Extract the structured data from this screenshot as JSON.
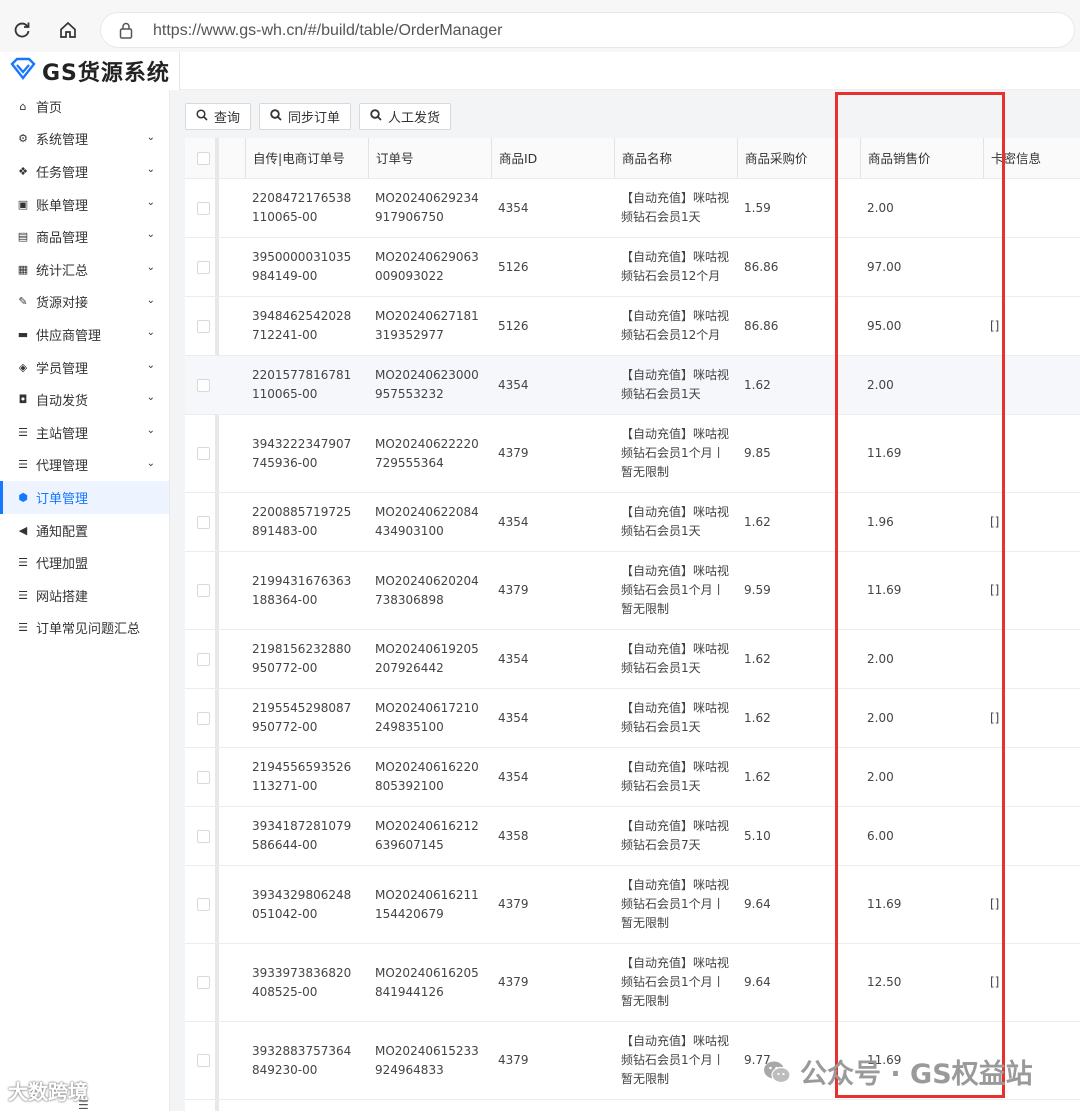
{
  "browser": {
    "url": "https://www.gs-wh.cn/#/build/table/OrderManager"
  },
  "app": {
    "title": "GS货源系统"
  },
  "sidebar": {
    "items": [
      {
        "label": "首页",
        "icon": "home-icon",
        "glyph": "⌂",
        "has_children": false,
        "active": false
      },
      {
        "label": "系统管理",
        "icon": "gears-icon",
        "glyph": "⚙",
        "has_children": true,
        "active": false
      },
      {
        "label": "任务管理",
        "icon": "cubes-icon",
        "glyph": "❖",
        "has_children": true,
        "active": false
      },
      {
        "label": "账单管理",
        "icon": "money-icon",
        "glyph": "▣",
        "has_children": true,
        "active": false
      },
      {
        "label": "商品管理",
        "icon": "calendar-icon",
        "glyph": "▤",
        "has_children": true,
        "active": false
      },
      {
        "label": "统计汇总",
        "icon": "table-icon",
        "glyph": "▦",
        "has_children": true,
        "active": false
      },
      {
        "label": "货源对接",
        "icon": "plug-icon",
        "glyph": "✎",
        "has_children": true,
        "active": false
      },
      {
        "label": "供应商管理",
        "icon": "archive-icon",
        "glyph": "▬",
        "has_children": true,
        "active": false
      },
      {
        "label": "学员管理",
        "icon": "tags-icon",
        "glyph": "◈",
        "has_children": true,
        "active": false
      },
      {
        "label": "自动发货",
        "icon": "car-icon",
        "glyph": "◘",
        "has_children": true,
        "active": false
      },
      {
        "label": "主站管理",
        "icon": "list-icon",
        "glyph": "☰",
        "has_children": true,
        "active": false
      },
      {
        "label": "代理管理",
        "icon": "list-icon",
        "glyph": "☰",
        "has_children": true,
        "active": false
      },
      {
        "label": "订单管理",
        "icon": "cube-icon",
        "glyph": "⬢",
        "has_children": false,
        "active": true
      },
      {
        "label": "通知配置",
        "icon": "bullhorn-icon",
        "glyph": "◀",
        "has_children": false,
        "active": false
      },
      {
        "label": "代理加盟",
        "icon": "list-icon",
        "glyph": "☰",
        "has_children": false,
        "active": false
      },
      {
        "label": "网站搭建",
        "icon": "list-icon",
        "glyph": "☰",
        "has_children": false,
        "active": false
      },
      {
        "label": "订单常见问题汇总",
        "icon": "list-icon",
        "glyph": "☰",
        "has_children": false,
        "active": false
      }
    ]
  },
  "toolbar": {
    "query_label": "查询",
    "sync_label": "同步订单",
    "manual_label": "人工发货"
  },
  "table": {
    "columns": [
      "自传|电商订单号",
      "订单号",
      "商品ID",
      "商品名称",
      "商品采购价",
      "商品销售价",
      "卡密信息"
    ],
    "rows": [
      {
        "ext_no": "2208472176538110065-00",
        "order_no": "MO20240629234917906750",
        "product_id": "4354",
        "product_name": "【自动充值】咪咕视频钻石会员1天",
        "cost": "1.59",
        "price": "2.00",
        "card": ""
      },
      {
        "ext_no": "3950000031035984149-00",
        "order_no": "MO20240629063009093022",
        "product_id": "5126",
        "product_name": "【自动充值】咪咕视频钻石会员12个月",
        "cost": "86.86",
        "price": "97.00",
        "card": ""
      },
      {
        "ext_no": "3948462542028712241-00",
        "order_no": "MO20240627181319352977",
        "product_id": "5126",
        "product_name": "【自动充值】咪咕视频钻石会员12个月",
        "cost": "86.86",
        "price": "95.00",
        "card": "[]"
      },
      {
        "ext_no": "2201577816781110065-00",
        "order_no": "MO20240623000957553232",
        "product_id": "4354",
        "product_name": "【自动充值】咪咕视频钻石会员1天",
        "cost": "1.62",
        "price": "2.00",
        "card": ""
      },
      {
        "ext_no": "3943222347907745936-00",
        "order_no": "MO20240622220729555364",
        "product_id": "4379",
        "product_name": "【自动充值】咪咕视频钻石会员1个月丨暂无限制",
        "cost": "9.85",
        "price": "11.69",
        "card": ""
      },
      {
        "ext_no": "2200885719725891483-00",
        "order_no": "MO20240622084434903100",
        "product_id": "4354",
        "product_name": "【自动充值】咪咕视频钻石会员1天",
        "cost": "1.62",
        "price": "1.96",
        "card": "[]"
      },
      {
        "ext_no": "2199431676363188364-00",
        "order_no": "MO20240620204738306898",
        "product_id": "4379",
        "product_name": "【自动充值】咪咕视频钻石会员1个月丨暂无限制",
        "cost": "9.59",
        "price": "11.69",
        "card": "[]"
      },
      {
        "ext_no": "2198156232880950772-00",
        "order_no": "MO20240619205207926442",
        "product_id": "4354",
        "product_name": "【自动充值】咪咕视频钻石会员1天",
        "cost": "1.62",
        "price": "2.00",
        "card": ""
      },
      {
        "ext_no": "2195545298087950772-00",
        "order_no": "MO20240617210249835100",
        "product_id": "4354",
        "product_name": "【自动充值】咪咕视频钻石会员1天",
        "cost": "1.62",
        "price": "2.00",
        "card": "[]"
      },
      {
        "ext_no": "2194556593526113271-00",
        "order_no": "MO20240616220805392100",
        "product_id": "4354",
        "product_name": "【自动充值】咪咕视频钻石会员1天",
        "cost": "1.62",
        "price": "2.00",
        "card": ""
      },
      {
        "ext_no": "3934187281079586644-00",
        "order_no": "MO20240616212639607145",
        "product_id": "4358",
        "product_name": "【自动充值】咪咕视频钻石会员7天",
        "cost": "5.10",
        "price": "6.00",
        "card": ""
      },
      {
        "ext_no": "3934329806248051042-00",
        "order_no": "MO20240616211154420679",
        "product_id": "4379",
        "product_name": "【自动充值】咪咕视频钻石会员1个月丨暂无限制",
        "cost": "9.64",
        "price": "11.69",
        "card": "[]"
      },
      {
        "ext_no": "3933973836820408525-00",
        "order_no": "MO20240616205841944126",
        "product_id": "4379",
        "product_name": "【自动充值】咪咕视频钻石会员1个月丨暂无限制",
        "cost": "9.64",
        "price": "12.50",
        "card": "[]"
      },
      {
        "ext_no": "3932883757364849230-00",
        "order_no": "MO20240615233924964833",
        "product_id": "4379",
        "product_name": "【自动充值】咪咕视频钻石会员1个月丨暂无限制",
        "cost": "9.77",
        "price": "11.69",
        "card": ""
      }
    ]
  },
  "watermark": {
    "left": "大数跨境",
    "right": "公众号 · GS权益站"
  },
  "colors": {
    "accent": "#1677ff",
    "highlight": "#e8312f"
  }
}
